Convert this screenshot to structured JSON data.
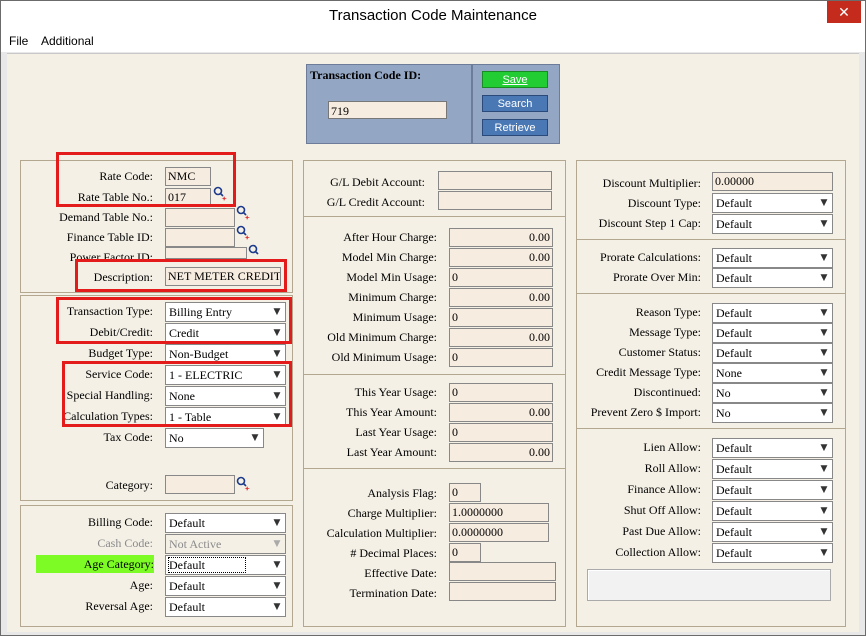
{
  "window": {
    "title": "Transaction Code Maintenance",
    "close": "✕"
  },
  "menu": {
    "file": "File",
    "additional": "Additional"
  },
  "header": {
    "tc_label": "Transaction Code ID:",
    "tc_value": "719",
    "save": "Save",
    "search": "Search",
    "retrieve": "Retrieve"
  },
  "left": {
    "rate_code_label": "Rate Code:",
    "rate_code": "NMC",
    "rate_table_label": "Rate Table No.:",
    "rate_table": "017",
    "demand_table_label": "Demand Table No.:",
    "finance_table_label": "Finance Table ID:",
    "power_factor_label": "Power Factor ID:",
    "description_label": "Description:",
    "description": "NET METER CREDIT",
    "transaction_type_label": "Transaction Type:",
    "transaction_type": "Billing Entry",
    "debit_credit_label": "Debit/Credit:",
    "debit_credit": "Credit",
    "budget_type_label": "Budget Type:",
    "budget_type": "Non-Budget",
    "service_code_label": "Service Code:",
    "service_code": "1 - ELECTRIC",
    "special_handling_label": "Special Handling:",
    "special_handling": "None",
    "calc_types_label": "Calculation Types:",
    "calc_types": "1 - Table",
    "tax_code_label": "Tax Code:",
    "tax_code": "No",
    "category_label": "Category:",
    "billing_code_label": "Billing Code:",
    "billing_code": "Default",
    "cash_code_label": "Cash Code:",
    "cash_code": "Not Active",
    "age_category_label": "Age Category:",
    "age_category": "Default",
    "age_label": "Age:",
    "age": "Default",
    "reversal_age_label": "Reversal Age:",
    "reversal_age": "Default"
  },
  "middle": {
    "gl_debit_label": "G/L Debit Account:",
    "gl_credit_label": "G/L Credit Account:",
    "after_hour_label": "After Hour Charge:",
    "after_hour": "0.00",
    "model_min_charge_label": "Model Min Charge:",
    "model_min_charge": "0.00",
    "model_min_usage_label": "Model Min Usage:",
    "model_min_usage": "0",
    "min_charge_label": "Minimum Charge:",
    "min_charge": "0.00",
    "min_usage_label": "Minimum Usage:",
    "min_usage": "0",
    "old_min_charge_label": "Old Minimum Charge:",
    "old_min_charge": "0.00",
    "old_min_usage_label": "Old Minimum Usage:",
    "old_min_usage": "0",
    "this_year_usage_label": "This Year Usage:",
    "this_year_usage": "0",
    "this_year_amount_label": "This Year Amount:",
    "this_year_amount": "0.00",
    "last_year_usage_label": "Last Year Usage:",
    "last_year_usage": "0",
    "last_year_amount_label": "Last Year Amount:",
    "last_year_amount": "0.00",
    "analysis_flag_label": "Analysis Flag:",
    "analysis_flag": "0",
    "charge_mult_label": "Charge Multiplier:",
    "charge_mult": "1.0000000",
    "calc_mult_label": "Calculation Multiplier:",
    "calc_mult": "0.0000000",
    "decimal_places_label": "# Decimal Places:",
    "decimal_places": "0",
    "effective_date_label": "Effective Date:",
    "termination_date_label": "Termination Date:"
  },
  "right": {
    "discount_mult_label": "Discount Multiplier:",
    "discount_mult": "0.00000",
    "discount_type_label": "Discount Type:",
    "discount_type": "Default",
    "discount_step_label": "Discount Step 1 Cap:",
    "discount_step": "Default",
    "prorate_calc_label": "Prorate Calculations:",
    "prorate_calc": "Default",
    "prorate_over_label": "Prorate Over Min:",
    "prorate_over": "Default",
    "reason_type_label": "Reason Type:",
    "reason_type": "Default",
    "message_type_label": "Message Type:",
    "message_type": "Default",
    "customer_status_label": "Customer Status:",
    "customer_status": "Default",
    "credit_msg_label": "Credit Message Type:",
    "credit_msg": "None",
    "discontinued_label": "Discontinued:",
    "discontinued": "No",
    "prevent_zero_label": "Prevent Zero $ Import:",
    "prevent_zero": "No",
    "lien_label": "Lien Allow:",
    "lien": "Default",
    "roll_label": "Roll Allow:",
    "roll": "Default",
    "finance_allow_label": "Finance Allow:",
    "finance_allow": "Default",
    "shut_off_label": "Shut Off Allow:",
    "shut_off": "Default",
    "past_due_label": "Past Due Allow:",
    "past_due": "Default",
    "collection_label": "Collection Allow:",
    "collection": "Default"
  },
  "colors": {
    "save_bg": "#22cc33",
    "button_bg": "#4a78b5",
    "panel_bg": "#93a6c4",
    "highlight": "#e41b1b",
    "age_highlight": "#7cfc24"
  }
}
